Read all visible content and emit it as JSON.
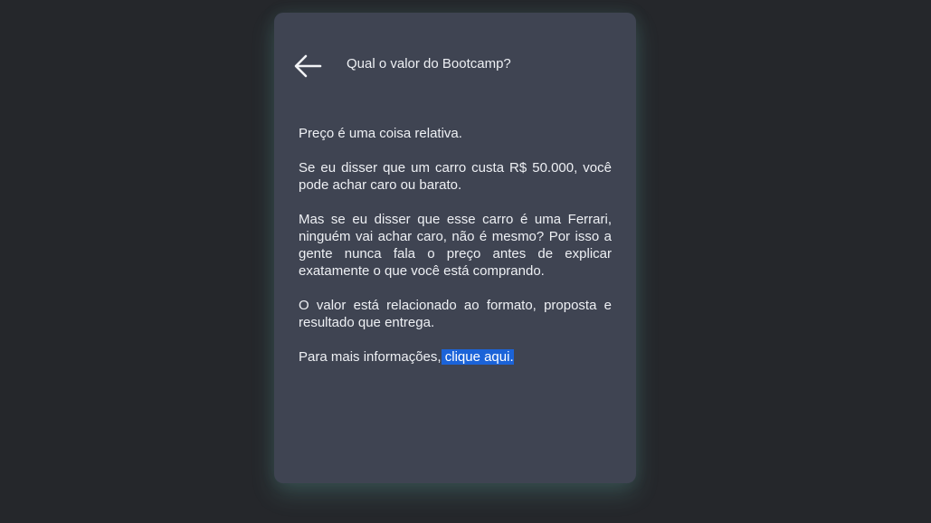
{
  "header": {
    "back_icon": "arrow-left-icon",
    "title": "Qual o valor do Bootcamp?"
  },
  "content": {
    "paragraphs": [
      "Preço é uma coisa relativa.",
      "Se eu disser que um carro custa R$ 50.000, você pode achar caro ou barato.",
      "Mas se eu disser que esse carro é uma Ferrari, ninguém vai achar caro, não é mesmo? Por isso a gente nunca fala o preço antes de explicar exatamente o que você está comprando.",
      "O valor está relacionado ao formato, proposta e resultado que entrega."
    ],
    "more_info_prefix": "Para mais informações,",
    "more_info_link": " clique aqui."
  },
  "colors": {
    "background": "#25272b",
    "card": "#3f4452",
    "text": "#eef0f4",
    "link_highlight": "#1b63d8",
    "glow": "#6ec8be"
  }
}
